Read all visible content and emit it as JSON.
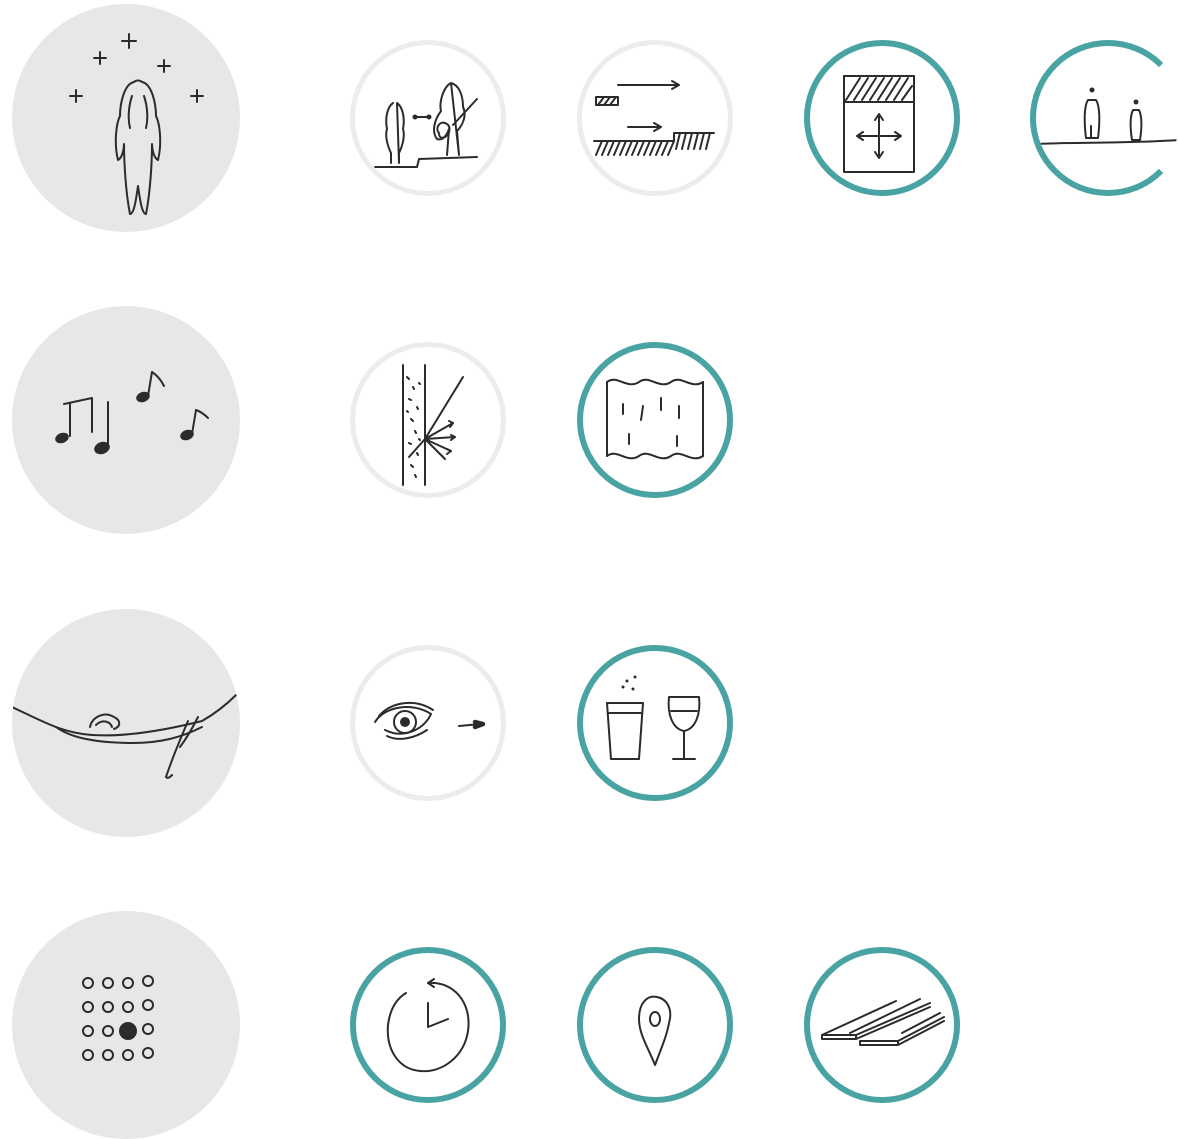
{
  "rows": [
    {
      "category": {
        "icon": "person-with-plus-signs-icon"
      },
      "items": [
        {
          "icon": "person-and-musician-icon",
          "state": "muted"
        },
        {
          "icon": "sound-travel-arrows-icon",
          "state": "muted"
        },
        {
          "icon": "expandable-panel-icon",
          "state": "active"
        },
        {
          "icon": "two-people-distance-icon",
          "state": "active"
        }
      ]
    },
    {
      "category": {
        "icon": "music-notes-icon"
      },
      "items": [
        {
          "icon": "sound-absorbing-wall-icon",
          "state": "muted"
        },
        {
          "icon": "curtain-icon",
          "state": "active"
        }
      ]
    },
    {
      "category": {
        "icon": "person-in-hammock-icon"
      },
      "items": [
        {
          "icon": "eye-looking-icon",
          "state": "muted"
        },
        {
          "icon": "glass-and-wine-glass-icon",
          "state": "active"
        }
      ]
    },
    {
      "category": {
        "icon": "dot-grid-icon"
      },
      "items": [
        {
          "icon": "clock-icon",
          "state": "active"
        },
        {
          "icon": "location-pin-icon",
          "state": "active"
        },
        {
          "icon": "wooden-planks-icon",
          "state": "active"
        }
      ]
    }
  ],
  "colors": {
    "accent": "#4aa3a3",
    "muted_ring": "#ececec",
    "category_fill": "#e6e7e8",
    "ink": "#2b2b2b"
  }
}
